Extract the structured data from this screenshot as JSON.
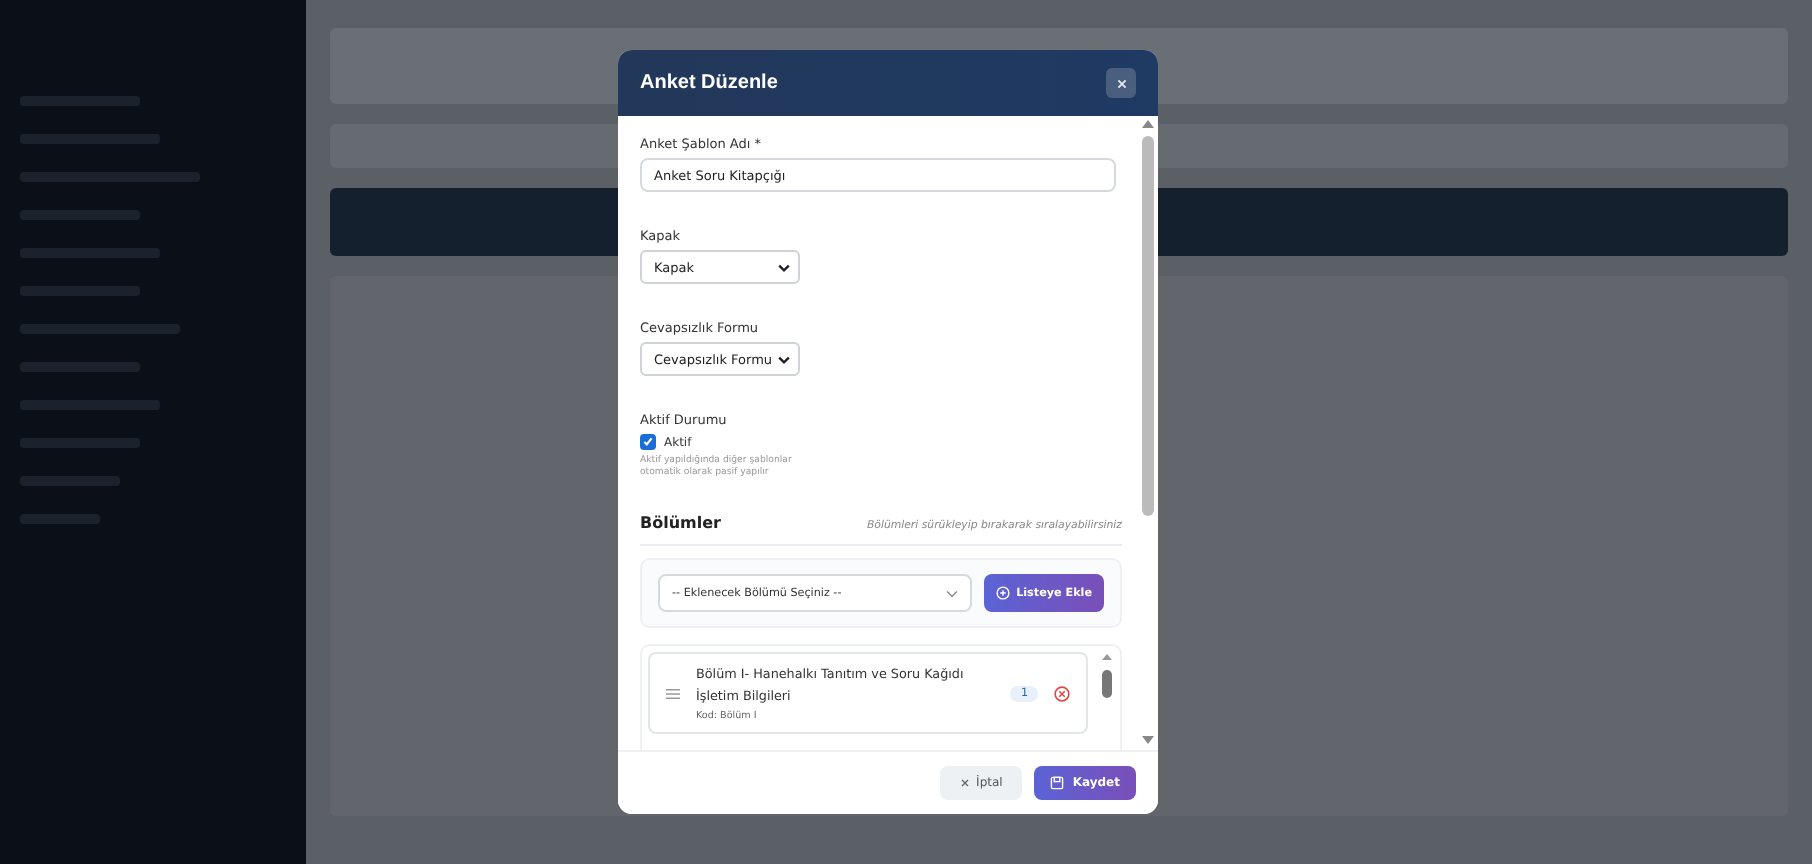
{
  "modal": {
    "title": "Anket Düzenle",
    "name_field": {
      "label": "Anket Şablon Adı *",
      "value": "Anket Soru Kitapçığı"
    },
    "selects": [
      {
        "label": "Kapak",
        "value": "Kapak"
      },
      {
        "label": "Cevapsızlık Formu",
        "value": "Cevapsızlık Formu"
      }
    ],
    "status": {
      "label": "Aktif Durumu",
      "checkbox_label": "Aktif",
      "checked": true,
      "hint": "Aktif yapıldığında diğer şablonlar otomatik olarak pasif yapılır"
    },
    "sections": {
      "title": "Bölümler",
      "hint": "Bölümleri sürükleyip bırakarak sıralayabilirsiniz",
      "picker_placeholder": "-- Eklenecek Bölümü Seçiniz --",
      "add_button": "Listeye Ekle",
      "items": [
        {
          "title": "Bölüm I- Hanehalkı Tanıtım ve Soru Kağıdı İşletim Bilgileri",
          "code": "Kod: Bölüm I",
          "count": "1"
        }
      ]
    },
    "buttons": {
      "cancel": "İptal",
      "save": "Kaydet"
    }
  }
}
